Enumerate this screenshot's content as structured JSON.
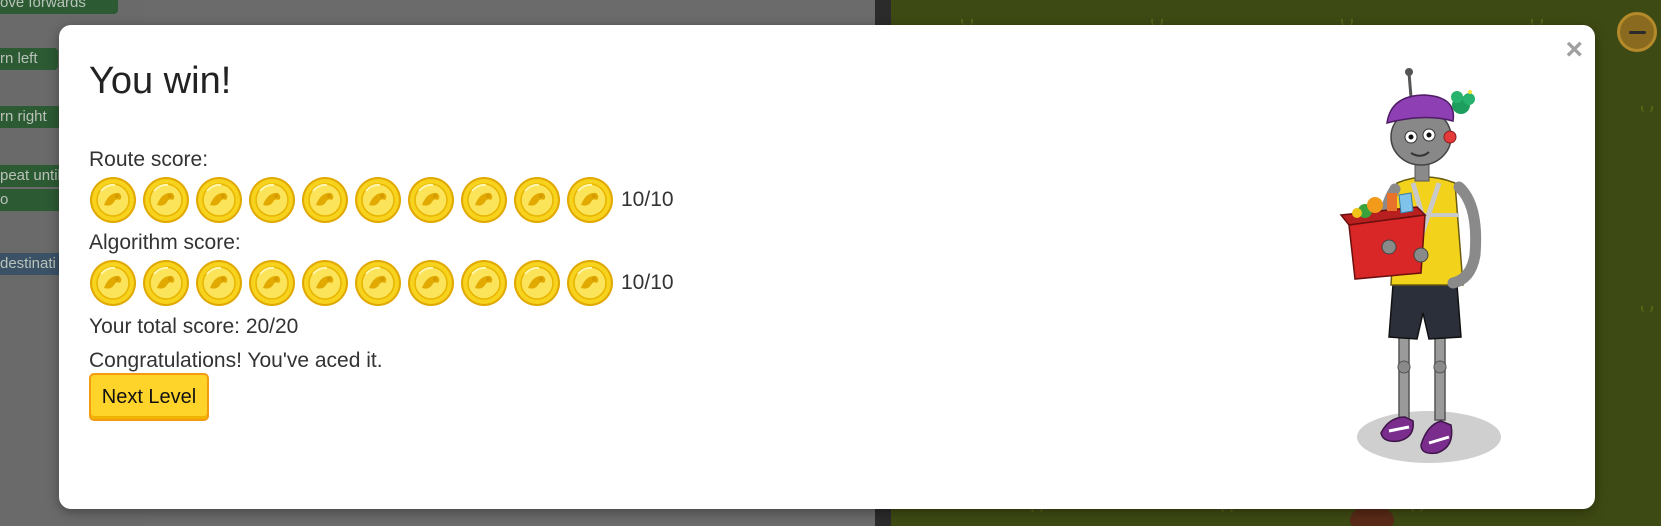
{
  "background": {
    "blocks": [
      {
        "label": "ove forwards"
      },
      {
        "label": "rn left"
      },
      {
        "label": "rn right"
      },
      {
        "label": "peat until"
      },
      {
        "label": "o"
      },
      {
        "label": "destinati"
      }
    ]
  },
  "modal": {
    "title": "You win!",
    "close_symbol": "×",
    "route_label": "Route score:",
    "route_score": "10/10",
    "route_coins": 10,
    "algorithm_label": "Algorithm score:",
    "algorithm_score": "10/10",
    "algorithm_coins": 10,
    "total_score": "Your total score: 20/20",
    "message": "Congratulations! You've aced it.",
    "next_button": "Next Level"
  },
  "colors": {
    "coin_gold": "#f7d31d",
    "button_bg": "#ffd42a",
    "button_border": "#f39c12",
    "map_bg": "#3e4a13"
  },
  "icons": {
    "close": "close-icon",
    "coin": "gold-coin-icon",
    "mascot": "robot-mascot-image"
  }
}
